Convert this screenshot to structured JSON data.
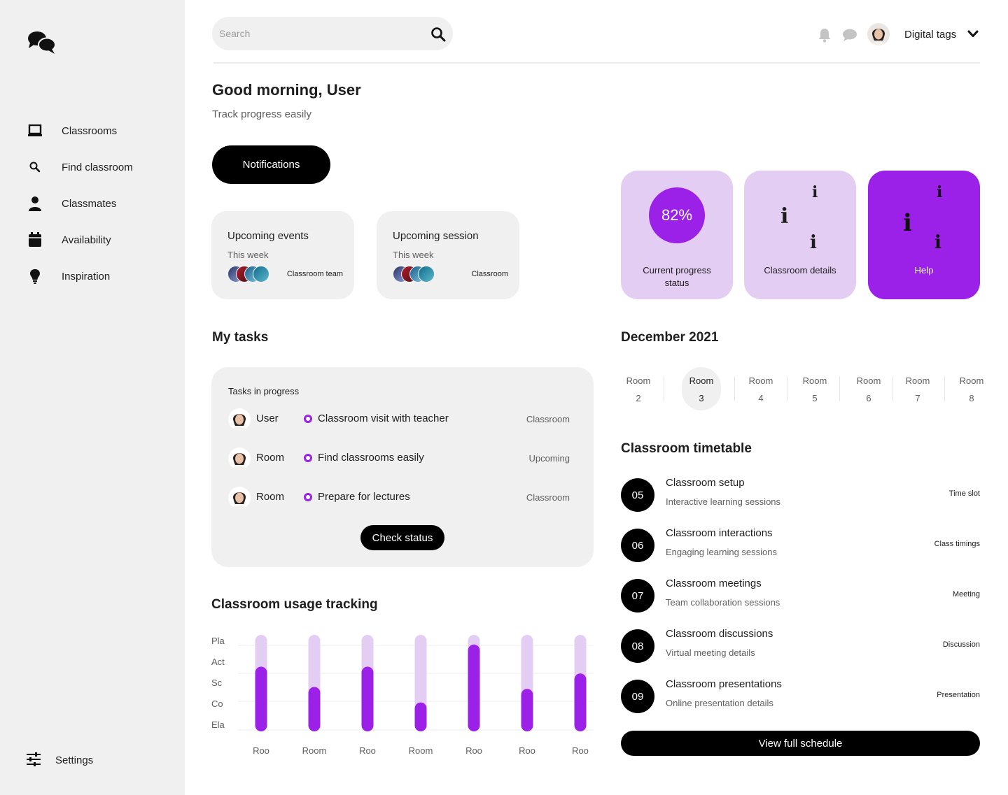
{
  "app": {
    "logo": "chat-bubbles-logo"
  },
  "sidebar": {
    "items": [
      {
        "label": "Classrooms",
        "icon": "laptop-icon"
      },
      {
        "label": "Find classroom",
        "icon": "search-icon"
      },
      {
        "label": "Classmates",
        "icon": "person-icon"
      },
      {
        "label": "Availability",
        "icon": "calendar-icon"
      },
      {
        "label": "Inspiration",
        "icon": "lightbulb-icon"
      }
    ],
    "settings_label": "Settings"
  },
  "header": {
    "search_placeholder": "Search",
    "user_name": "Digital tags"
  },
  "greeting": {
    "title": "Good morning, User",
    "subtitle": "Track progress easily",
    "notifications_button": "Notifications"
  },
  "upcoming": [
    {
      "title": "Upcoming events",
      "sub": "This week",
      "tag": "Classroom team"
    },
    {
      "title": "Upcoming session",
      "sub": "This week",
      "tag": "Classroom"
    }
  ],
  "tiles": {
    "progress_value": "82%",
    "progress_label": "Current progress status",
    "details_label": "Classroom details",
    "help_label": "Help",
    "accent": "#9b20e8",
    "light": "#e4cdf3"
  },
  "tasks": {
    "section_title": "My tasks",
    "head": "Tasks in progress",
    "rows": [
      {
        "who": "User",
        "task": "Classroom visit with teacher",
        "status": "Classroom"
      },
      {
        "who": "Room",
        "task": "Find classrooms easily",
        "status": "Upcoming"
      },
      {
        "who": "Room",
        "task": "Prepare for lectures",
        "status": "Classroom"
      }
    ],
    "check_button": "Check status"
  },
  "calendar": {
    "month": "December 2021",
    "rooms": [
      {
        "label": "Room",
        "num": "2"
      },
      {
        "label": "Room",
        "num": "3",
        "selected": true
      },
      {
        "label": "Room",
        "num": "4"
      },
      {
        "label": "Room",
        "num": "5"
      },
      {
        "label": "Room",
        "num": "6"
      },
      {
        "label": "Room",
        "num": "7"
      },
      {
        "label": "Room",
        "num": "8"
      }
    ]
  },
  "timetable": {
    "title": "Classroom timetable",
    "rows": [
      {
        "num": "05",
        "title": "Classroom setup",
        "sub": "Interactive learning sessions",
        "tag": "Time slot"
      },
      {
        "num": "06",
        "title": "Classroom interactions",
        "sub": "Engaging learning sessions",
        "tag": "Class timings"
      },
      {
        "num": "07",
        "title": "Classroom meetings",
        "sub": "Team collaboration sessions",
        "tag": "Meeting"
      },
      {
        "num": "08",
        "title": "Classroom discussions",
        "sub": "Virtual meeting details",
        "tag": "Discussion"
      },
      {
        "num": "09",
        "title": "Classroom presentations",
        "sub": "Online presentation details",
        "tag": "Presentation"
      }
    ],
    "button": "View full schedule"
  },
  "usage": {
    "title": "Classroom usage tracking"
  },
  "chart_data": {
    "type": "bar",
    "title": "Classroom usage tracking",
    "y_tick_labels": [
      "Pla",
      "Act",
      "Sc",
      "Co",
      "Ela"
    ],
    "categories": [
      "Roo",
      "Room",
      "Roo",
      "Room",
      "Roo",
      "Roo",
      "Roo"
    ],
    "values": [
      0.67,
      0.46,
      0.67,
      0.3,
      0.9,
      0.44,
      0.6
    ],
    "ylim": [
      0,
      1
    ],
    "bar_color": "#9b20e8",
    "track_color": "#e4cdf3",
    "grid": true
  }
}
